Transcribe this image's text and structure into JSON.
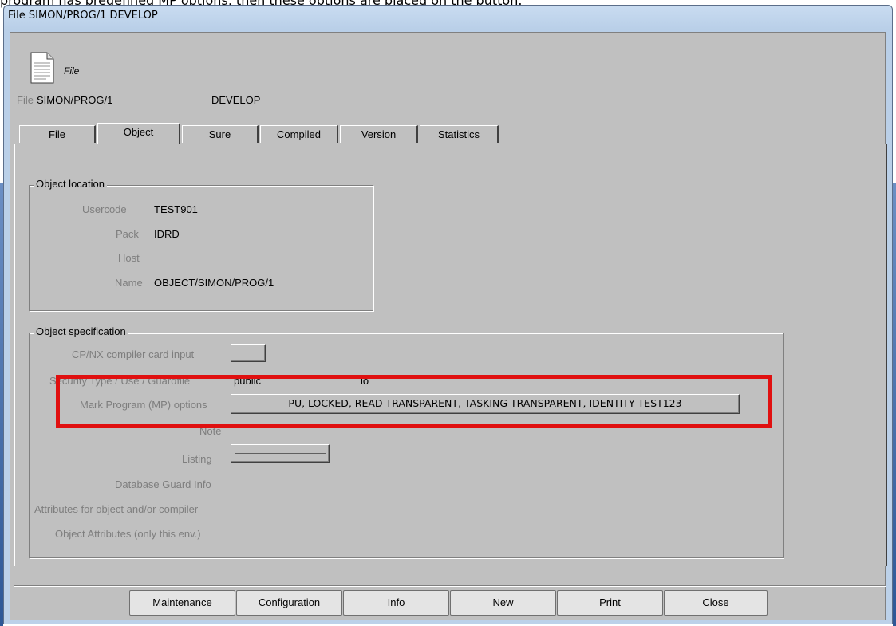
{
  "caption": "program has predefined MP options, then these options are placed on the button.",
  "window": {
    "title": "File SIMON/PROG/1 DEVELOP"
  },
  "header": {
    "icon_caption": "File",
    "file_label": "File",
    "file_name": "SIMON/PROG/1",
    "environment": "DEVELOP"
  },
  "tabs": [
    {
      "label": "File",
      "active": false
    },
    {
      "label": "Object",
      "active": true
    },
    {
      "label": "Sure",
      "active": false
    },
    {
      "label": "Compiled",
      "active": false
    },
    {
      "label": "Version",
      "active": false
    },
    {
      "label": "Statistics",
      "active": false
    }
  ],
  "object_location": {
    "title": "Object location",
    "usercode_label": "Usercode",
    "usercode_value": "TEST901",
    "pack_label": "Pack",
    "pack_value": "IDRD",
    "host_label": "Host",
    "host_value": "",
    "name_label": "Name",
    "name_value": "OBJECT/SIMON/PROG/1"
  },
  "object_specification": {
    "title": "Object specification",
    "cpnx_label": "CP/NX compiler card input",
    "security_label": "Security  Type / Use / Guardfile",
    "security_type": "public",
    "security_use": "io",
    "mp_label": "Mark Program (MP) options",
    "mp_button": "PU, LOCKED, READ TRANSPARENT, TASKING TRANSPARENT, IDENTITY TEST123",
    "note_label": "Note",
    "listing_label": "Listing",
    "db_guard_label": "Database Guard Info",
    "attributes_label": "Attributes for object and/or compiler",
    "object_attributes_label": "Object Attributes (only this env.)"
  },
  "buttons": {
    "maintenance": "Maintenance",
    "configuration": "Configuration",
    "info": "Info",
    "new": "New",
    "print": "Print",
    "close": "Close"
  },
  "colors": {
    "highlight": "#e01010",
    "dialog_background": "#c0c0c0"
  }
}
